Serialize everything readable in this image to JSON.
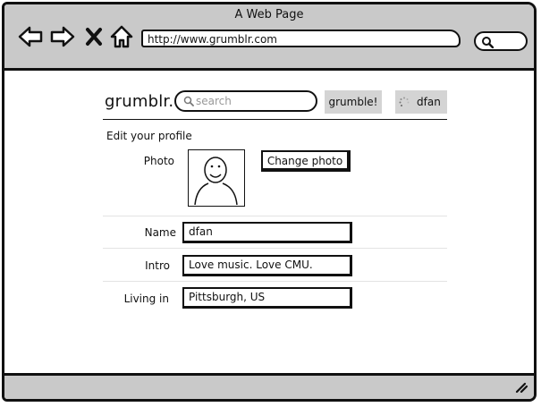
{
  "browser": {
    "window_title": "A Web Page",
    "url": "http://www.grumblr.com"
  },
  "header": {
    "logo": "grumblr.",
    "search_placeholder": "search",
    "grumble_label": "grumble!",
    "username": "dfan"
  },
  "profile": {
    "section_title": "Edit your profile",
    "photo_label": "Photo",
    "change_photo_label": "Change photo",
    "name_label": "Name",
    "name_value": "dfan",
    "intro_label": "Intro",
    "intro_value": "Love music. Love CMU.",
    "location_label": "Living in",
    "location_value": "Pittsburgh, US"
  },
  "icons": {
    "back": "arrow-left-icon",
    "forward": "arrow-right-icon",
    "stop": "close-icon",
    "home": "home-icon",
    "browser_search": "search-icon",
    "user_avatar": "loading-icon",
    "resize": "resize-grip-icon"
  }
}
